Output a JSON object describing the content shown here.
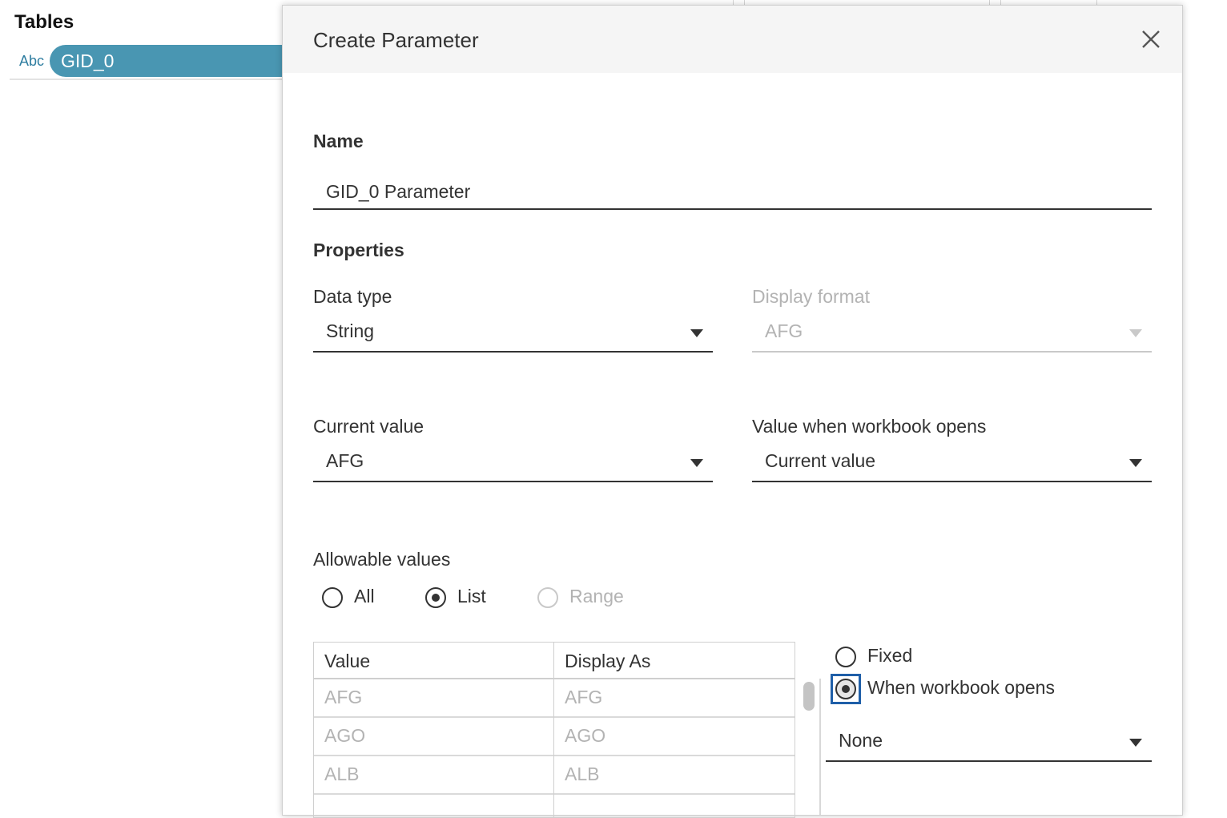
{
  "left_pane": {
    "title": "Tables",
    "field_type": "Abc",
    "field_name": "GID_0"
  },
  "dialog": {
    "title": "Create Parameter",
    "name_section": "Name",
    "name_value": "GID_0 Parameter",
    "properties_section": "Properties",
    "data_type_label": "Data type",
    "data_type_value": "String",
    "display_format_label": "Display format",
    "display_format_value": "AFG",
    "current_value_label": "Current value",
    "current_value_value": "AFG",
    "workbook_opens_label": "Value when workbook opens",
    "workbook_opens_value": "Current value",
    "allowable_label": "Allowable values",
    "allowable_options": {
      "all": "All",
      "list": "List",
      "range": "Range",
      "selected": "List"
    },
    "table": {
      "headers": [
        "Value",
        "Display As"
      ],
      "rows": [
        [
          "AFG",
          "AFG"
        ],
        [
          "AGO",
          "AGO"
        ],
        [
          "ALB",
          "ALB"
        ]
      ]
    },
    "list_source": {
      "fixed": "Fixed",
      "when_opens": "When workbook opens",
      "selected": "When workbook opens",
      "field_value": "None"
    }
  },
  "icons": {
    "close": "close-icon",
    "caret": "chevron-down-icon"
  },
  "colors": {
    "pill": "#4996b2",
    "focus": "#1f5fa8",
    "disabled_text": "#b3b3b3"
  }
}
